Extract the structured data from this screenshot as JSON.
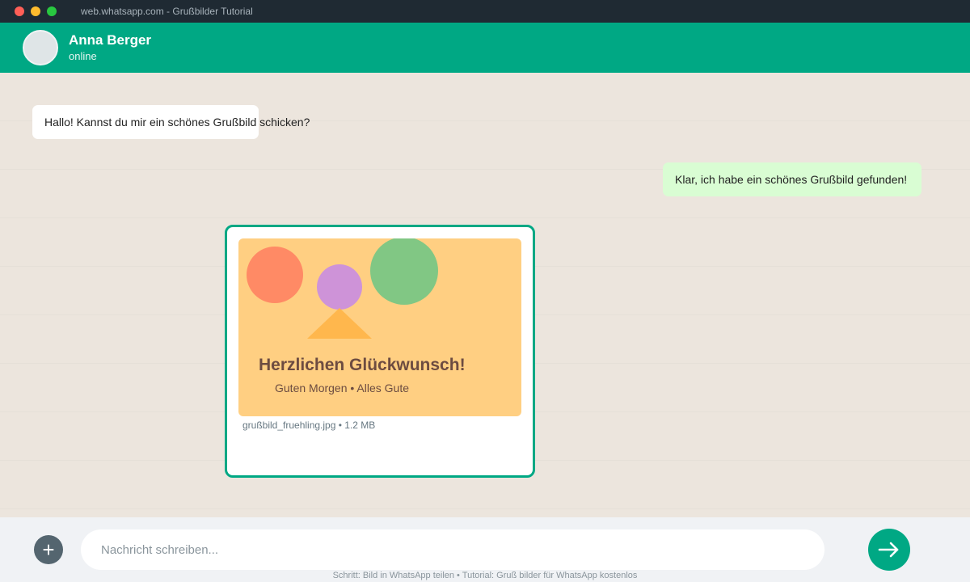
{
  "window": {
    "title": "web.whatsapp.com - Grußbilder Tutorial"
  },
  "contact": {
    "name": "Anna Berger",
    "status": "online"
  },
  "messages": [
    {
      "direction": "incoming",
      "text": "Hallo! Kannst du mir ein schönes Grußbild schicken?"
    },
    {
      "direction": "outgoing",
      "text": "Klar, ich habe ein schönes Grußbild gefunden!"
    }
  ],
  "image_message": {
    "title": "Herzlichen Glückwunsch!",
    "subtitle": "Guten Morgen • Alles Gute",
    "file_caption": "grußbild_fruehling.jpg • 1.2 MB"
  },
  "compose": {
    "placeholder": "Nachricht schreiben...",
    "attach_icon": "plus-icon",
    "send_icon": "arrow-right-icon"
  },
  "footer": {
    "note": "Schritt: Bild in WhatsApp teilen • Tutorial: Gruß bilder für WhatsApp kostenlos"
  },
  "colors": {
    "brand": "#00a884",
    "outgoing_bubble": "#d9fdd3",
    "chat_background": "#ece5dd",
    "image_background": "#ffcf82"
  }
}
